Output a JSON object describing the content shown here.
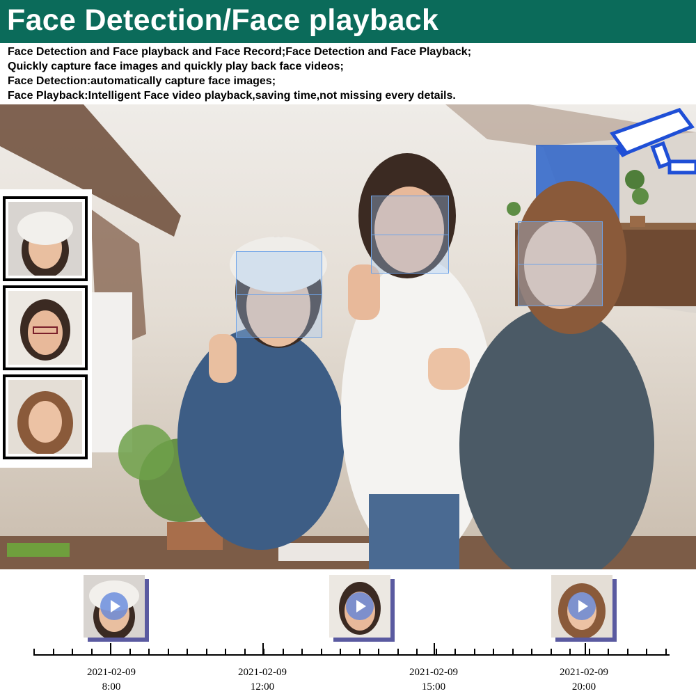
{
  "header": {
    "title": "Face Detection/Face playback",
    "lines": [
      "Face Detection and Face playback and Face Record;Face Detection and Face Playback;",
      "Quickly capture face images and quickly play back face videos;",
      "Face Detection:automatically capture face images;",
      "Face Playback:Intelligent Face video playback,saving time,not missing every details."
    ]
  },
  "colors": {
    "banner": "#0b6b5a",
    "detect_box": "#6ea3e8",
    "camera": "#1f4fd6",
    "clip_shadow": "#5a5aa0"
  },
  "camera_icon": "cctv-camera-icon",
  "timeline": {
    "entries": [
      {
        "date": "2021-02-09",
        "time": "8:00"
      },
      {
        "date": "2021-02-09",
        "time": "12:00"
      },
      {
        "date": "2021-02-09",
        "time": "15:00"
      },
      {
        "date": "2021-02-09",
        "time": "20:00"
      }
    ]
  }
}
